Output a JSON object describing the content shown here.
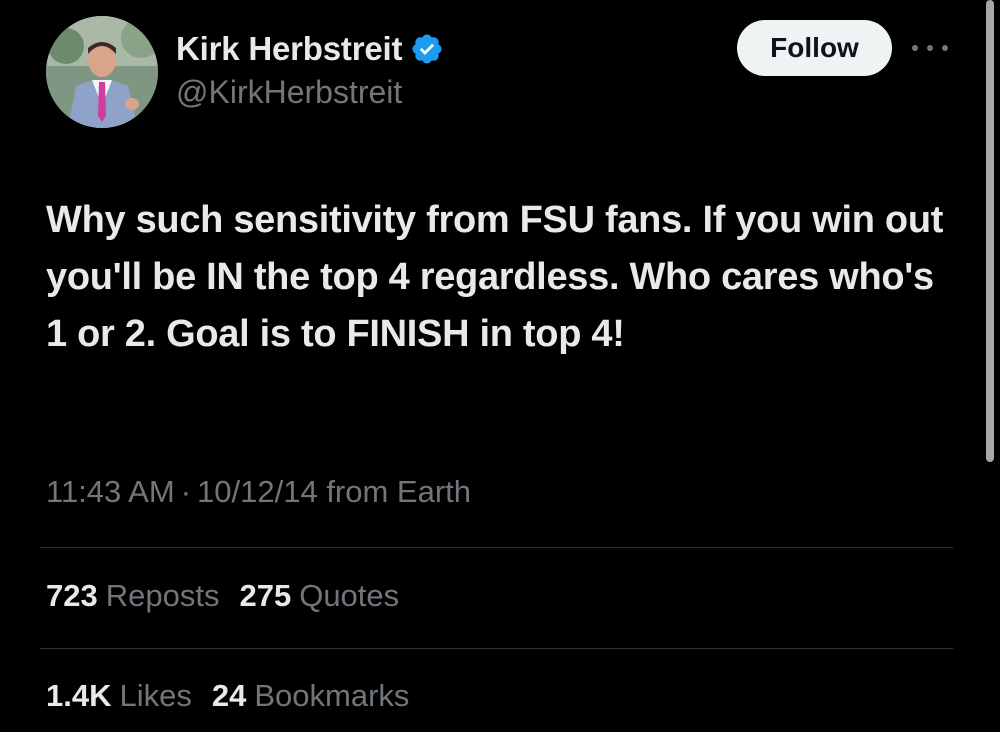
{
  "user": {
    "display_name": "Kirk Herbstreit",
    "handle": "@KirkHerbstreit",
    "verified": true
  },
  "actions": {
    "follow_label": "Follow",
    "more_icon": "more-horizontal-icon"
  },
  "tweet": {
    "text": "Why such sensitivity from FSU fans. If you win out you'll be IN the top 4 regardless. Who cares who's 1 or 2. Goal is to FINISH in top 4!",
    "time": "11:43 AM",
    "separator": "·",
    "date": "10/12/14",
    "source": "from Earth"
  },
  "stats": {
    "reposts_count": "723",
    "reposts_label": "Reposts",
    "quotes_count": "275",
    "quotes_label": "Quotes",
    "likes_count": "1.4K",
    "likes_label": "Likes",
    "bookmarks_count": "24",
    "bookmarks_label": "Bookmarks"
  },
  "colors": {
    "background": "#000000",
    "primary_text": "#e7e9ea",
    "secondary_text": "#71767b",
    "verified_blue": "#1d9bf0",
    "follow_bg": "#eff3f4",
    "divider": "#2f3336"
  }
}
